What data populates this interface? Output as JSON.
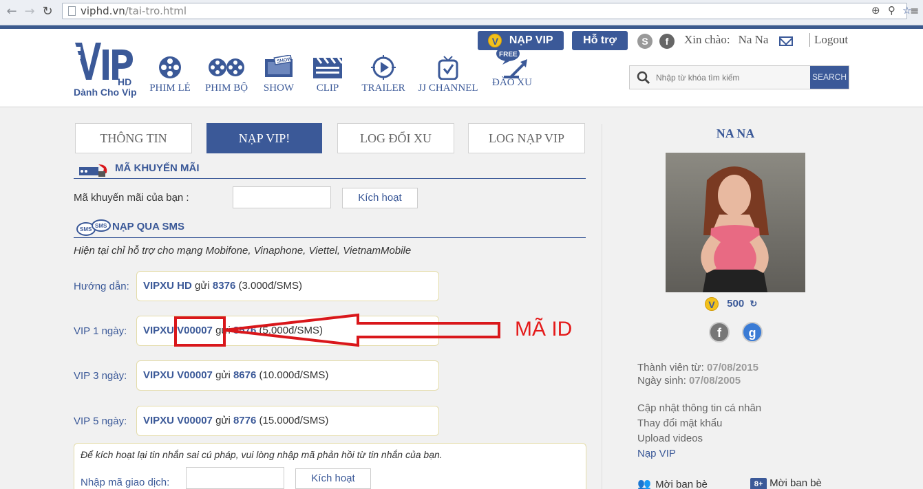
{
  "browser": {
    "url_domain": "viphd.vn",
    "url_path": "/tai-tro.html"
  },
  "header": {
    "logo_text": "VIP",
    "logo_sub": "HD",
    "logo_tagline": "Dành Cho Vip",
    "nav": [
      {
        "label": "PHIM LẺ",
        "icon": "film-reel-icon"
      },
      {
        "label": "PHIM BỘ",
        "icon": "film-reels-icon"
      },
      {
        "label": "SHOW",
        "icon": "show-tv-icon"
      },
      {
        "label": "CLIP",
        "icon": "clapperboard-icon"
      },
      {
        "label": "TRAILER",
        "icon": "trailer-play-icon"
      },
      {
        "label": "JJ CHANNEL",
        "icon": "tv-channel-icon"
      },
      {
        "label": "ĐÀO XU",
        "icon": "free-shovel-icon"
      }
    ],
    "nap_vip": "NẠP VIP",
    "ho_tro": "Hỗ trợ",
    "greeting": "Xin chào:",
    "username": "Na Na",
    "logout": "Logout",
    "search_placeholder": "Nhập từ khóa tìm kiếm",
    "search_button": "SEARCH"
  },
  "tabs": [
    {
      "label": "THÔNG TIN",
      "active": false
    },
    {
      "label": "NẠP VIP!",
      "active": true
    },
    {
      "label": "LOG ĐỔI XU",
      "active": false
    },
    {
      "label": "LOG NẠP VIP",
      "active": false
    }
  ],
  "promo": {
    "title": "MÃ KHUYẾN MÃI",
    "label": "Mã khuyến mãi của bạn :",
    "button": "Kích hoạt"
  },
  "sms": {
    "title": "NẠP QUA SMS",
    "note": "Hiện tại chỉ hỗ trợ cho mạng Mobifone, Vinaphone, Viettel, VietnamMobile",
    "rows": [
      {
        "label": "Hướng dẫn:",
        "code": "VIPXU HD",
        "send": "gửi",
        "number": "8376",
        "price": "(3.000đ/SMS)"
      },
      {
        "label": "VIP 1 ngày:",
        "code": "VIPXU V00007",
        "send": "gửi",
        "number": "8576",
        "price": "(5.000đ/SMS)"
      },
      {
        "label": "VIP 3 ngày:",
        "code": "VIPXU V00007",
        "send": "gửi",
        "number": "8676",
        "price": "(10.000đ/SMS)"
      },
      {
        "label": "VIP 5 ngày:",
        "code": "VIPXU V00007",
        "send": "gửi",
        "number": "8776",
        "price": "(15.000đ/SMS)"
      }
    ],
    "retry_note": "Để kích hoạt lại tin nhắn sai cú pháp, vui lòng nhập mã phản hồi từ tin nhắn của bạn.",
    "transaction_label": "Nhập mã giao dịch:",
    "transaction_button": "Kích hoạt"
  },
  "annotation": {
    "text": "MÃ ID",
    "color": "#d9171b"
  },
  "sidebar": {
    "name": "NA NA",
    "coins": "500",
    "member_since_label": "Thành viên từ:",
    "member_since": "07/08/2015",
    "birthday_label": "Ngày sinh:",
    "birthday": "07/08/2005",
    "links": [
      "Cập nhật thông tin cá nhân",
      "Thay đổi mật khẩu",
      "Upload videos",
      "Nạp VIP"
    ],
    "friends_1": "Mời ban bè",
    "friends_2": "Mời ban bè"
  },
  "colors": {
    "brand": "#3b5998",
    "annotation_red": "#d9171b"
  }
}
